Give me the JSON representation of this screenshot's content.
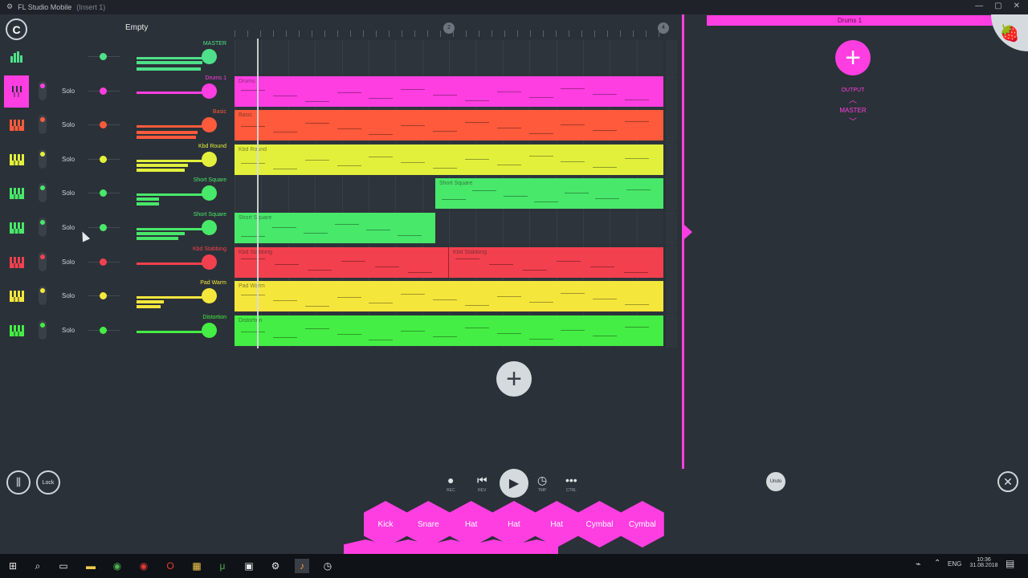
{
  "window": {
    "title": "FL Studio Mobile",
    "subtitle": "(Insert 1)",
    "controls": [
      "—",
      "▢",
      "✕"
    ]
  },
  "header": {
    "logo_glyph": "C",
    "song_name": "Empty",
    "ruler_markers": [
      "2",
      "4"
    ]
  },
  "tracks": [
    {
      "name": "MASTER",
      "color": "#4ee08a",
      "solo_label": "",
      "clips": []
    },
    {
      "name": "Drums 1",
      "color": "#ff3ee1",
      "solo_label": "Solo",
      "clips": [
        {
          "label": "Drums"
        }
      ]
    },
    {
      "name": "Basic",
      "color": "#ff5a3c",
      "solo_label": "Solo",
      "clips": [
        {
          "label": "Basic"
        }
      ]
    },
    {
      "name": "Kbd Round",
      "color": "#e2f03c",
      "solo_label": "Solo",
      "clips": [
        {
          "label": "Kbd Round"
        }
      ]
    },
    {
      "name": "Short Square",
      "color": "#48e86a",
      "solo_label": "Solo",
      "clips": [
        {
          "label": "Short Square"
        }
      ]
    },
    {
      "name": "Short Square",
      "color": "#48e86a",
      "solo_label": "Solo",
      "clips": [
        {
          "label": "Short Square"
        }
      ]
    },
    {
      "name": "Kbd Stabbing",
      "color": "#f3404e",
      "solo_label": "Solo",
      "clips": [
        {
          "label": "Kbd Stabbing"
        },
        {
          "label": "Kbd Stabbing"
        }
      ]
    },
    {
      "name": "Pad Warm",
      "color": "#f5e63c",
      "solo_label": "Solo",
      "clips": [
        {
          "label": "Pad Warm"
        }
      ]
    },
    {
      "name": "Distortion",
      "color": "#44ee44",
      "solo_label": "Solo",
      "clips": [
        {
          "label": "Distortion"
        }
      ]
    }
  ],
  "right_panel": {
    "header": "Drums 1",
    "output_label": "OUTPUT",
    "output_target": "MASTER",
    "add_glyph": "+",
    "up_glyph": "︿",
    "down_glyph": "﹀"
  },
  "bottom": {
    "lock_label": "Lock",
    "rec_label": "REC",
    "rev_label": "REV",
    "tmp_label": "TMP",
    "ctrl_label": "CTRL",
    "undo_label": "Undo",
    "pads": [
      "Kick",
      "Snare",
      "Hat",
      "Hat",
      "Hat",
      "Cymbal",
      "Cymbal"
    ]
  },
  "taskbar": {
    "lang": "ENG",
    "time": "10:36",
    "date": "31.08.2018"
  },
  "colors": {
    "accent": "#ff3ee1",
    "background": "#2b3138"
  }
}
